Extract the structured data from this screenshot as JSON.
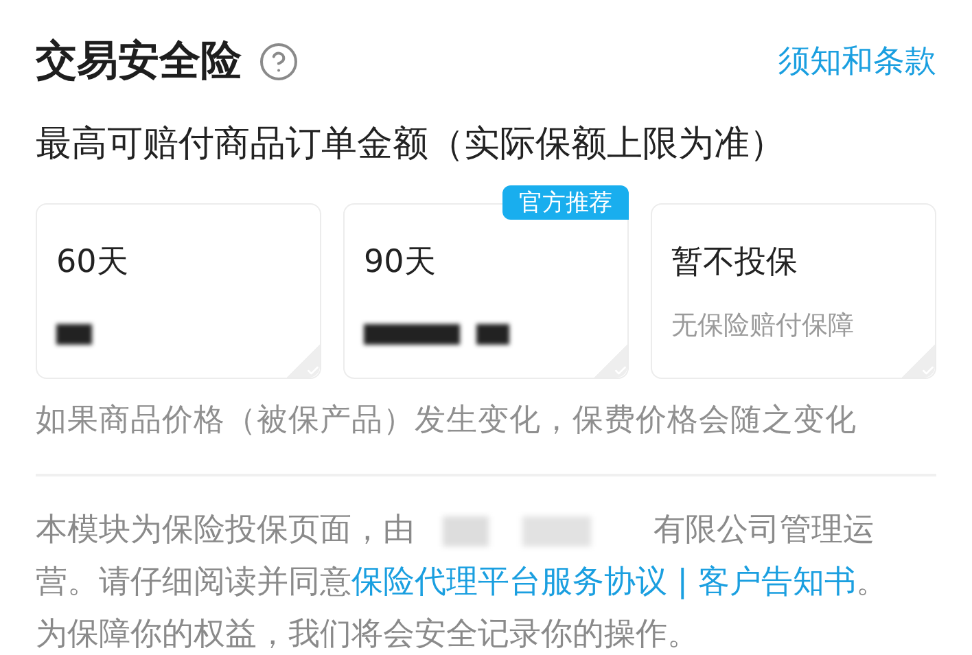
{
  "header": {
    "title": "交易安全险",
    "link": "须知和条款"
  },
  "subtitle": "最高可赔付商品订单金额（实际保额上限为准）",
  "options": [
    {
      "label": "60天",
      "price_hidden": true,
      "selected": false
    },
    {
      "label": "90天",
      "badge": "官方推荐",
      "price_hidden": true,
      "selected": false
    },
    {
      "label": "暂不投保",
      "note": "无保险赔付保障",
      "selected": false
    }
  ],
  "change_note": "如果商品价格（被保产品）发生变化，保费价格会随之变化",
  "disclaimer": [
    {
      "kind": "text",
      "text": "本模块为保险投保页面，由"
    },
    {
      "kind": "redacted"
    },
    {
      "kind": "text",
      "text": "有限公司管理运营。请仔细阅读并同意"
    },
    {
      "kind": "link",
      "text": "保险代理平台服务协议 | 客户告知书"
    },
    {
      "kind": "text",
      "text": "。为保障你的权益，我们将会安全记录你的操作。"
    }
  ]
}
